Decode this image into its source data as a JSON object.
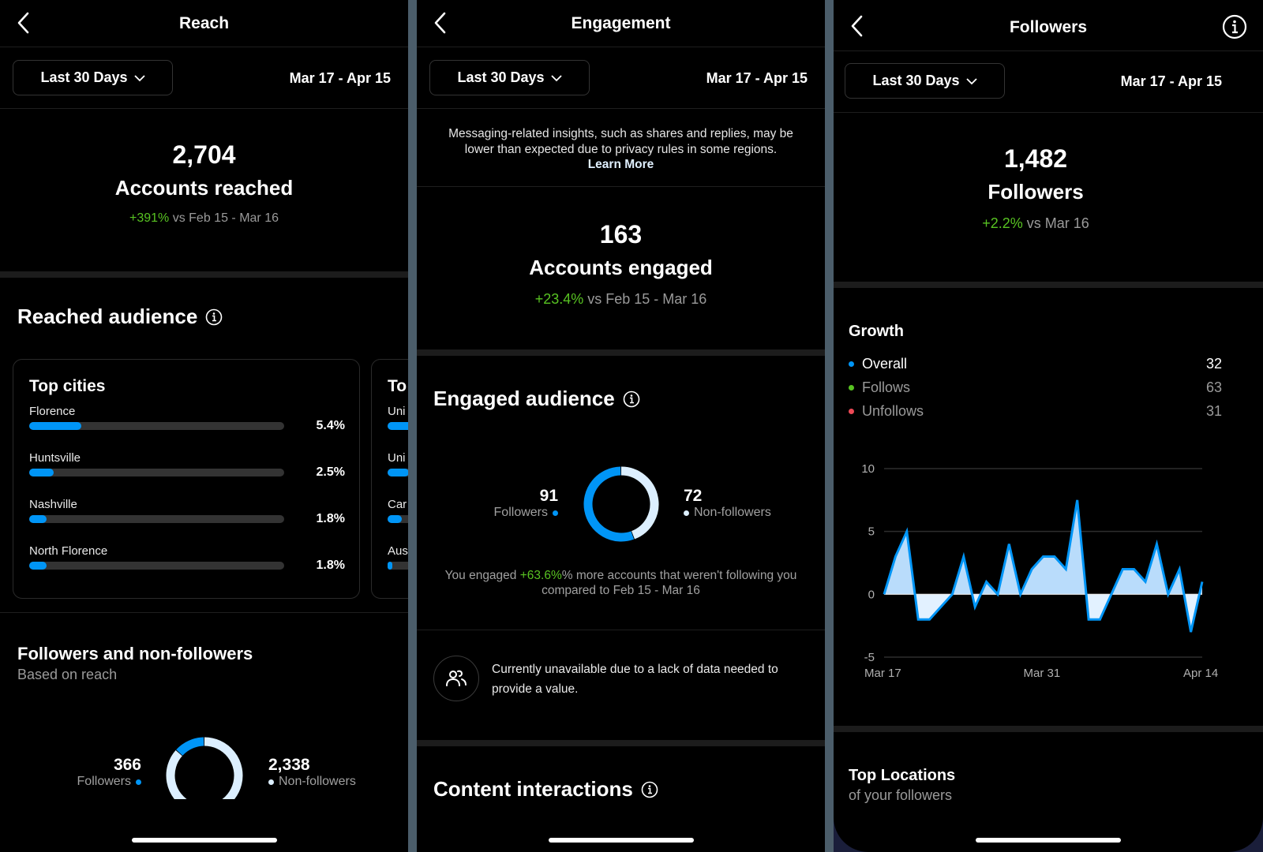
{
  "colors": {
    "accent_blue": "#0095f6",
    "light_blue": "#dcefff",
    "positive_green": "#58c322",
    "negative_red": "#ed4956"
  },
  "reach": {
    "title": "Reach",
    "range_label": "Last 30 Days",
    "date_range": "Mar 17 - Apr 15",
    "kpi_value": "2,704",
    "kpi_label": "Accounts reached",
    "kpi_change": "+391%",
    "kpi_compare": " vs Feb 15 - Mar 16",
    "section_title": "Reached audience",
    "top_cities": {
      "title": "Top cities",
      "items": [
        {
          "name": "Florence",
          "percent_label": "5.4%",
          "percent": 5.4
        },
        {
          "name": "Huntsville",
          "percent_label": "2.5%",
          "percent": 2.5
        },
        {
          "name": "Nashville",
          "percent_label": "1.8%",
          "percent": 1.8
        },
        {
          "name": "North Florence",
          "percent_label": "1.8%",
          "percent": 1.8
        }
      ]
    },
    "top_next_card": {
      "title_partial": "To",
      "items_partial": [
        "Uni",
        "Uni",
        "Car",
        "Aus"
      ]
    },
    "followers_section": {
      "title": "Followers and non-followers",
      "subtitle": "Based on reach",
      "followers_value": "366",
      "followers_label": "Followers",
      "non_followers_value": "2,338",
      "non_followers_label": "Non-followers",
      "followers_count": 366,
      "non_followers_count": 2338
    }
  },
  "engagement": {
    "title": "Engagement",
    "range_label": "Last 30 Days",
    "date_range": "Mar 17 - Apr 15",
    "notice_text": "Messaging-related insights, such as shares and replies, may be lower than expected due to privacy rules in some regions. ",
    "notice_link": "Learn More",
    "kpi_value": "163",
    "kpi_label": "Accounts engaged",
    "kpi_change": "+23.4%",
    "kpi_compare": " vs Feb 15 - Mar 16",
    "section_title": "Engaged audience",
    "followers_value": "91",
    "followers_label": "Followers",
    "non_followers_value": "72",
    "non_followers_label": "Non-followers",
    "followers_count": 91,
    "non_followers_count": 72,
    "summary_prefix": "You engaged ",
    "summary_change": "+63.6%",
    "summary_suffix": "% more accounts that weren't following you compared to Feb 15 - Mar 16",
    "unavailable_text": "Currently unavailable due to a lack of data needed to provide a value.",
    "content_title": "Content interactions"
  },
  "followers": {
    "title": "Followers",
    "range_label": "Last 30 Days",
    "date_range": "Mar 17 - Apr 15",
    "kpi_value": "1,482",
    "kpi_label": "Followers",
    "kpi_change": "+2.2%",
    "kpi_compare": " vs Mar 16",
    "growth_title": "Growth",
    "legend": [
      {
        "name": "Overall",
        "value": "32",
        "color": "#0095f6"
      },
      {
        "name": "Follows",
        "value": "63",
        "color": "#58c322"
      },
      {
        "name": "Unfollows",
        "value": "31",
        "color": "#ed4956"
      }
    ],
    "top_locations_title": "Top Locations",
    "top_locations_subtitle": "of your followers"
  },
  "chart_data": {
    "type": "area",
    "title": "Growth",
    "series": [
      {
        "name": "Overall",
        "values": [
          0,
          3,
          5,
          -2,
          -2,
          -1,
          0,
          3,
          -1,
          1,
          0,
          4,
          0,
          2,
          3,
          3,
          2,
          7.5,
          -2,
          -2,
          0,
          2,
          2,
          1,
          4,
          0,
          2,
          -3,
          1
        ]
      }
    ],
    "x_tick_labels": [
      "Mar 17",
      "Mar 31",
      "Apr 14"
    ],
    "y_ticks": [
      10,
      5,
      0,
      -5
    ],
    "ylim": [
      -5,
      10
    ],
    "grid": true,
    "xlabel": "",
    "ylabel": ""
  }
}
